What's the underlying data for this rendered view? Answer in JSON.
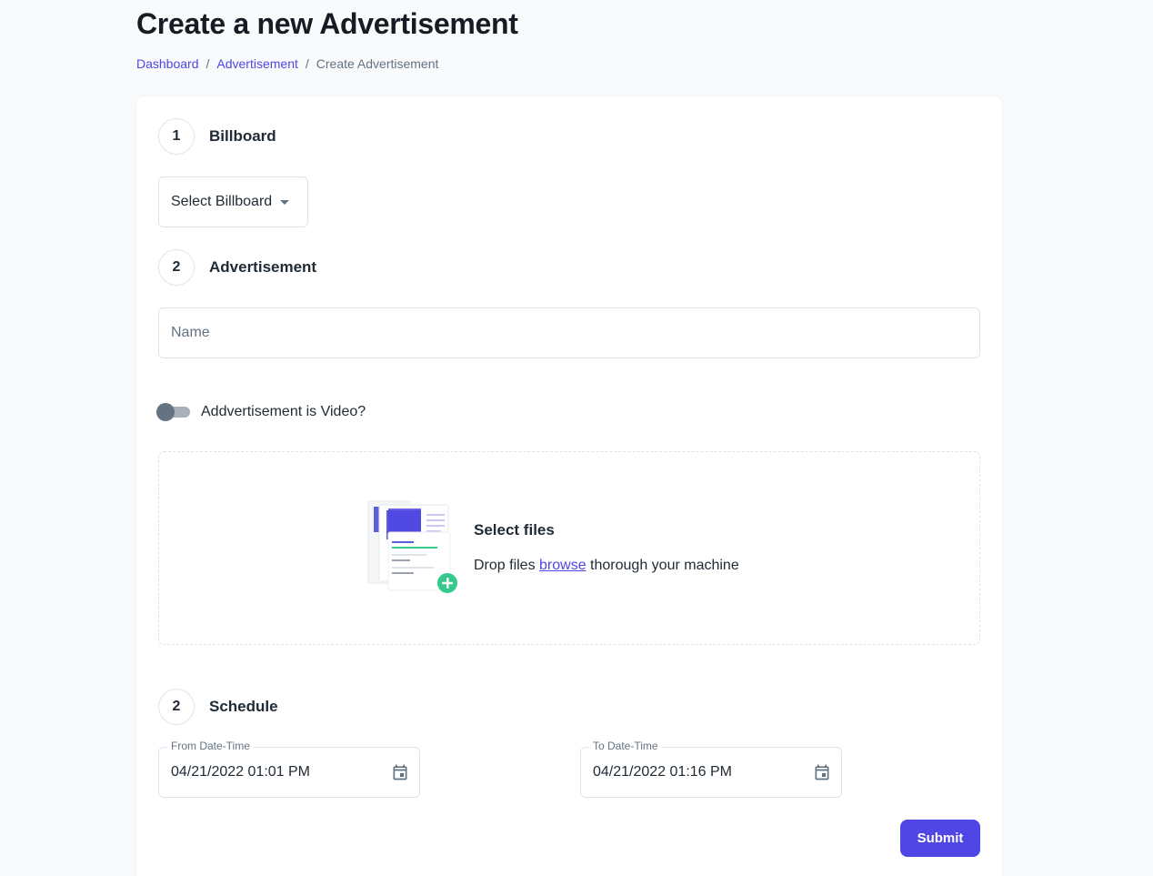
{
  "page": {
    "title": "Create a new Advertisement"
  },
  "breadcrumb": [
    {
      "label": "Dashboard"
    },
    {
      "label": "Advertisement"
    },
    {
      "label": "Create Advertisement"
    }
  ],
  "separator": "/",
  "steps": {
    "billboard": {
      "number": "1",
      "label": "Billboard"
    },
    "advertisement": {
      "number": "2",
      "label": "Advertisement"
    },
    "schedule": {
      "number": "2",
      "label": "Schedule"
    }
  },
  "billboard_select": {
    "value": "Select Billboard"
  },
  "name_input": {
    "placeholder": "Name",
    "value": ""
  },
  "video_toggle": {
    "label": "Addvertisement is Video?",
    "checked": false
  },
  "dropzone": {
    "title": "Select files",
    "desc_before": "Drop files ",
    "browse_link": "browse",
    "desc_after": " thorough your machine"
  },
  "schedule": {
    "from": {
      "legend": "From Date-Time",
      "value": "04/21/2022 01:01 PM"
    },
    "to": {
      "legend": "To Date-Time",
      "value": "04/21/2022 01:16 PM"
    }
  },
  "submit_label": "Submit",
  "colors": {
    "primary": "#4f46e5",
    "border": "#dfe3e8",
    "text": "#212b36",
    "muted": "#637381",
    "success": "#36c98d"
  }
}
